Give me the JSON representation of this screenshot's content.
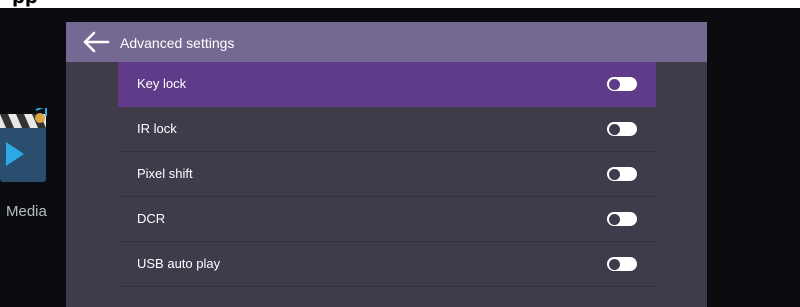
{
  "heading_fragment": "pp",
  "launcher": {
    "media_label": "Media",
    "media_icon": "media-clapperboard-icon"
  },
  "panel": {
    "title": "Advanced settings",
    "back_icon": "back-arrow-icon",
    "items": [
      {
        "label": "Key lock",
        "selected": true,
        "on": false
      },
      {
        "label": "IR lock",
        "selected": false,
        "on": false
      },
      {
        "label": "Pixel shift",
        "selected": false,
        "on": false
      },
      {
        "label": "DCR",
        "selected": false,
        "on": false
      },
      {
        "label": "USB auto play",
        "selected": false,
        "on": false
      }
    ]
  },
  "colors": {
    "header": "#746993",
    "panel": "#3f3b4b",
    "selected_row": "#5f3b8a",
    "toggle": "#ffffff"
  }
}
